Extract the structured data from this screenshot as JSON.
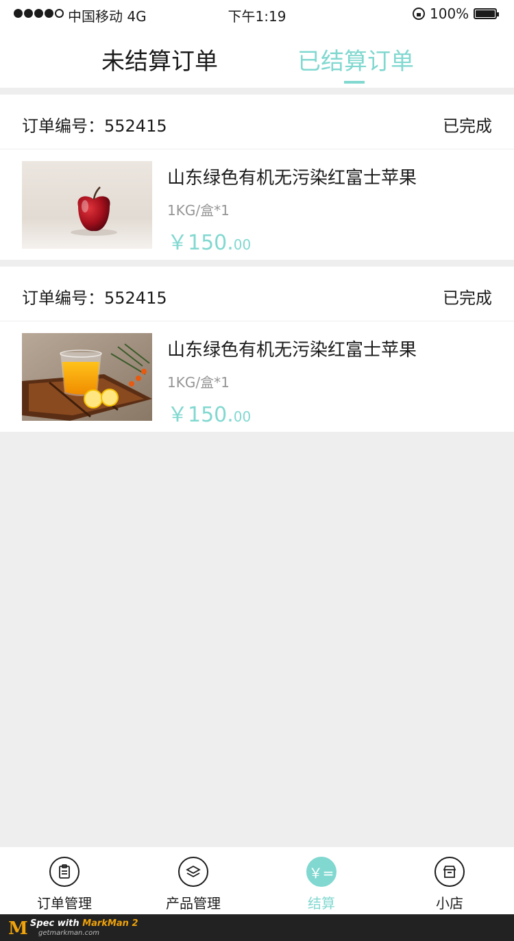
{
  "status_bar": {
    "carrier": "中国移动 4G",
    "time": "下午1:19",
    "battery": "100%"
  },
  "tabs": [
    {
      "label": "未结算订单",
      "active": false
    },
    {
      "label": "已结算订单",
      "active": true
    }
  ],
  "orders": [
    {
      "order_no": "订单编号：552415",
      "status": "已完成",
      "product_name": "山东绿色有机无污染红富士苹果",
      "spec": "1KG/盒*1",
      "price_int": "￥150.",
      "price_dec": "00",
      "image": "apple-image"
    },
    {
      "order_no": "订单编号：552415",
      "status": "已完成",
      "product_name": "山东绿色有机无污染红富士苹果",
      "spec": "1KG/盒*1",
      "price_int": "￥150.",
      "price_dec": "00",
      "image": "juice-image"
    }
  ],
  "bottom_nav": [
    {
      "label": "订单管理",
      "icon": "clipboard-icon",
      "active": false
    },
    {
      "label": "产品管理",
      "icon": "layers-icon",
      "active": false
    },
    {
      "label": "结算",
      "icon": "yen-icon",
      "active": true,
      "glyph": "￥="
    },
    {
      "label": "小店",
      "icon": "shop-icon",
      "active": false
    }
  ],
  "colors": {
    "accent": "#81d8d0",
    "text": "#1b1b1b",
    "secondary": "#959595",
    "divider": "#eeeeee"
  },
  "markman": {
    "logo": "M",
    "prefix": "Spec with ",
    "brand": "MarkMan 2",
    "url": "getmarkman.com"
  }
}
